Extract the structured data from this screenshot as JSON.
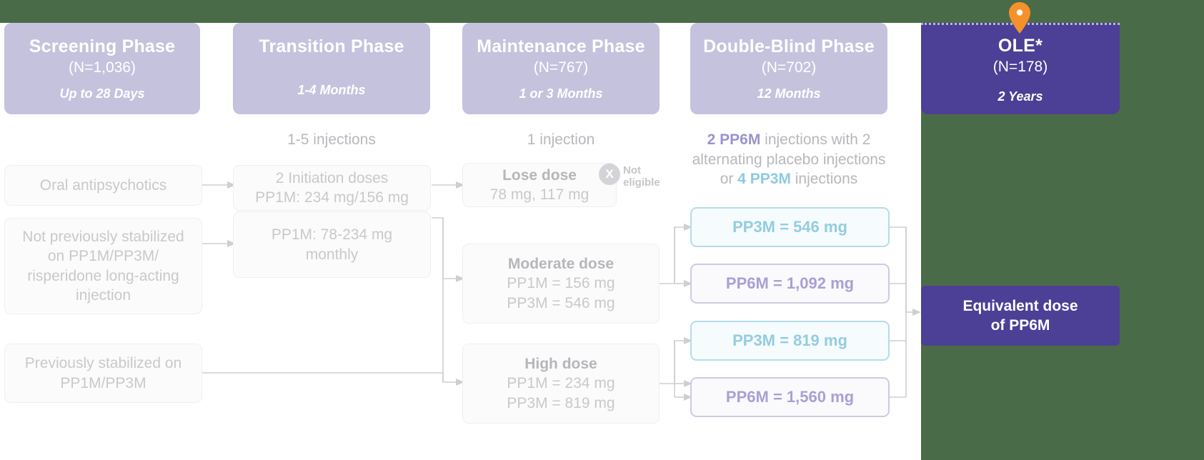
{
  "theme": {
    "page_background": "#4a6b47",
    "panel_background": "#ffffff",
    "phase_header_fill": "#c5c2de",
    "ole_fill": "#4c3f96",
    "pin_color": "#f5912a",
    "pp3m_color": "#8ecae0",
    "pp6m_color": "#9a93cf",
    "muted_text": "#c9c9cd",
    "connector_color": "#cfcfd3"
  },
  "phases": [
    {
      "title": "Screening Phase",
      "n": "(N=1,036)",
      "duration": "Up to 28 Days"
    },
    {
      "title": "Transition Phase",
      "n": "",
      "duration": "1-4 Months"
    },
    {
      "title": "Maintenance Phase",
      "n": "(N=767)",
      "duration": "1 or 3 Months"
    },
    {
      "title": "Double-Blind Phase",
      "n": "(N=702)",
      "duration": "12 Months"
    }
  ],
  "ole": {
    "title": "OLE*",
    "n": "(N=178)",
    "duration": "2 Years",
    "pin_icon": "map-pin-icon",
    "equivalent_dose_line1": "Equivalent dose",
    "equivalent_dose_line2": "of PP6M"
  },
  "captions": {
    "transition": "1-5 injections",
    "maintenance": "1 injection",
    "double_blind": {
      "seg1_bold": "2 PP6M",
      "seg2": " injections with 2",
      "line2": "alternating placebo injections",
      "line3_pre": "or ",
      "line3_bold": "4 PP3M",
      "line3_post": " injections"
    }
  },
  "screening_boxes": [
    {
      "text": "Oral antipsychotics"
    },
    {
      "text": "Not previously stabilized on PP1M/PP3M/ risperidone long-acting injection"
    },
    {
      "text": "Previously stabilized on PP1M/PP3M"
    }
  ],
  "transition_boxes": [
    {
      "line1": "2 Initiation doses",
      "line2": "PP1M: 234 mg/156 mg"
    },
    {
      "line1": "PP1M: 78-234 mg",
      "line2": "monthly"
    }
  ],
  "maintenance_boxes": [
    {
      "heading": "Lose dose",
      "line1": "78 mg, 117 mg",
      "line2": ""
    },
    {
      "heading": "Moderate dose",
      "line1": "PP1M = 156 mg",
      "line2": "PP3M = 546 mg"
    },
    {
      "heading": "High dose",
      "line1": "PP1M = 234 mg",
      "line2": "PP3M = 819 mg"
    }
  ],
  "not_eligible": {
    "badge": "X",
    "line1": "Not",
    "line2": "eligible"
  },
  "double_blind_boxes": [
    {
      "label": "PP3M = 546 mg",
      "kind": "pp3m"
    },
    {
      "label": "PP6M = 1,092 mg",
      "kind": "pp6m"
    },
    {
      "label": "PP3M = 819 mg",
      "kind": "pp3m"
    },
    {
      "label": "PP6M = 1,560 mg",
      "kind": "pp6m"
    }
  ]
}
